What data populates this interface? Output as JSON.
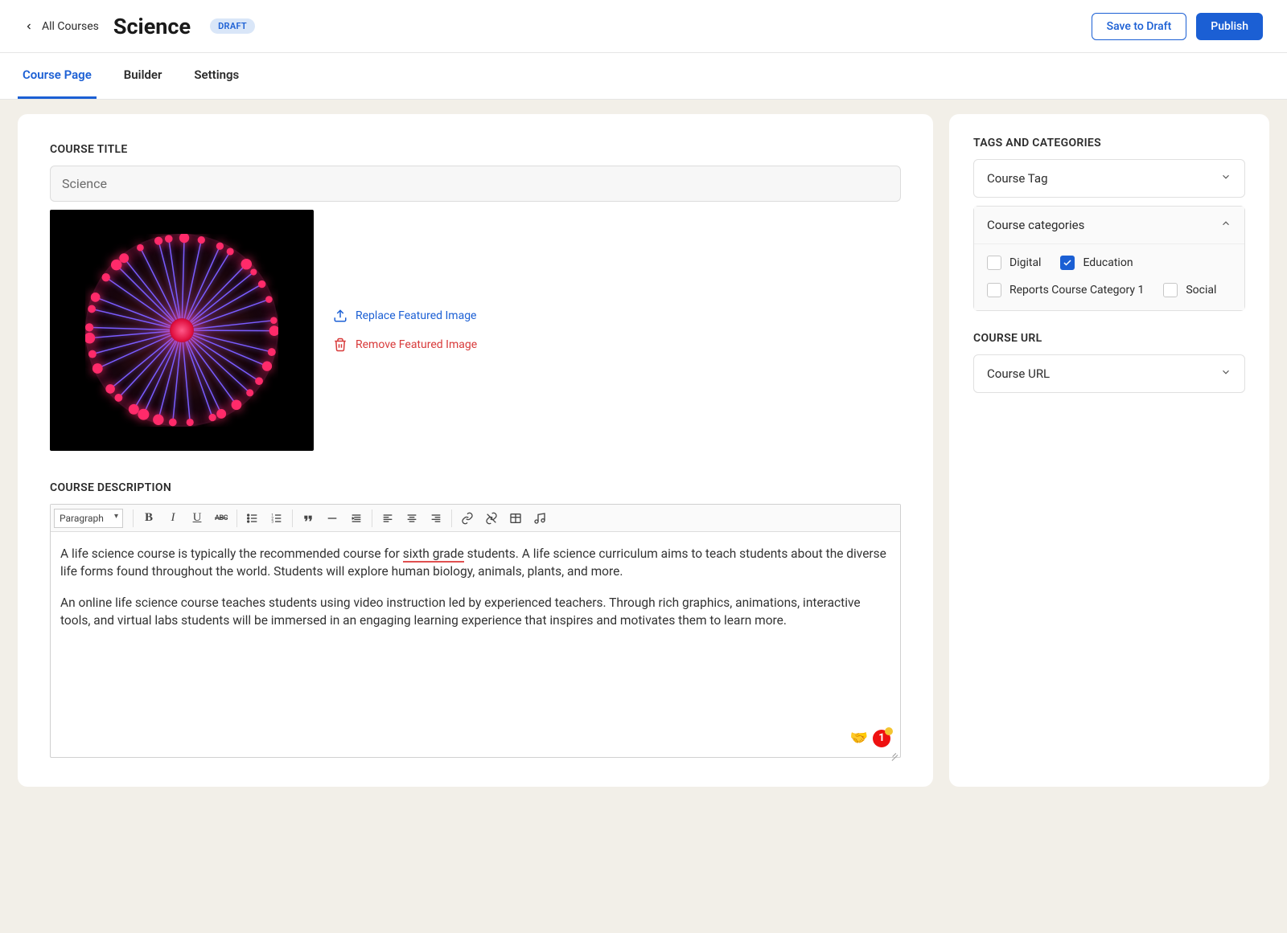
{
  "header": {
    "back_label": "All Courses",
    "course_name": "Science",
    "status_badge": "DRAFT",
    "save_draft_label": "Save to Draft",
    "publish_label": "Publish"
  },
  "tabs": [
    "Course Page",
    "Builder",
    "Settings"
  ],
  "active_tab_index": 0,
  "main": {
    "title_section_label": "COURSE TITLE",
    "title_value": "Science",
    "replace_image_label": "Replace Featured Image",
    "remove_image_label": "Remove Featured Image",
    "desc_section_label": "COURSE DESCRIPTION",
    "format_select": "Paragraph",
    "desc_p1_before": "A life science course is typically the recommended course for ",
    "desc_p1_err": "sixth grade",
    "desc_p1_after": " students. A life science curriculum aims to teach students about the diverse life forms found throughout the world. Students will explore human biology, animals, plants, and more.",
    "desc_p2": "An online life science course teaches students using video instruction led by experienced teachers. Through rich graphics, animations, interactive tools, and virtual labs students will be immersed in an engaging learning experience that inspires and motivates them to learn more.",
    "notif_count": "1"
  },
  "sidebar": {
    "tags_section_label": "TAGS AND CATEGORIES",
    "course_tag_label": "Course Tag",
    "course_cats_label": "Course categories",
    "categories": [
      {
        "label": "Digital",
        "checked": false
      },
      {
        "label": "Education",
        "checked": true
      },
      {
        "label": "Reports Course Category 1",
        "checked": false
      },
      {
        "label": "Social",
        "checked": false
      }
    ],
    "url_section_label": "COURSE URL",
    "course_url_label": "Course URL"
  }
}
